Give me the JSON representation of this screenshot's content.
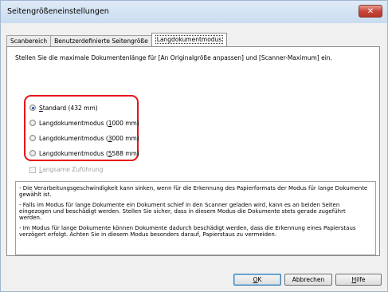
{
  "window": {
    "title": "Seitengrößeneinstellungen",
    "close_glyph": "✕"
  },
  "tabs": [
    {
      "label": "Scanbereich"
    },
    {
      "label": "Benutzerdefinierte Seitengröße"
    },
    {
      "label": "Langdokumentmodus"
    }
  ],
  "panel": {
    "intro": "Stellen Sie die maximale Dokumentenlänge für [An Originalgröße anpassen] und [Scanner-Maximum] ein.",
    "options": [
      {
        "pre": "",
        "key": "S",
        "post": "tandard (432 mm)",
        "checked": true
      },
      {
        "pre": "Langdokumentmodus (",
        "key": "1",
        "post": "000 mm)",
        "checked": false
      },
      {
        "pre": "Langdokumentmodus (",
        "key": "3",
        "post": "000 mm)",
        "checked": false
      },
      {
        "pre": "Langdokumentmodus (",
        "key": "5",
        "post": "588 mm)",
        "checked": false
      }
    ],
    "slow_feed": {
      "pre": "",
      "key": "L",
      "post": "angsame Zuführung",
      "checked": false,
      "enabled": false
    },
    "notes": [
      "- Die Verarbeitungsgeschwindigkeit kann sinken, wenn für die Erkennung des Papierformats der Modus für lange Dokumente gewählt ist.",
      "- Falls im Modus für lange Dokumente ein Dokument schief in den Scanner geladen wird, kann es an beiden Seiten eingezogen und beschädigt werden. Stellen Sie sicher, dass in diesem Modus die Dokumente stets gerade zugeführt werden.",
      "- Im Modus für lange Dokumente können Dokumente dadurch beschädigt werden, dass die Erkennung eines Papierstaus verzögert erfolgt. Achten Sie in diesem Modus besonders darauf, Papierstaus zu vermeiden."
    ],
    "highlight_color": "#e8121a"
  },
  "buttons": {
    "ok": {
      "key": "O",
      "post": "K"
    },
    "cancel": {
      "label": "Abbrechen"
    },
    "help": {
      "key": "H",
      "post": "ilfe"
    }
  }
}
